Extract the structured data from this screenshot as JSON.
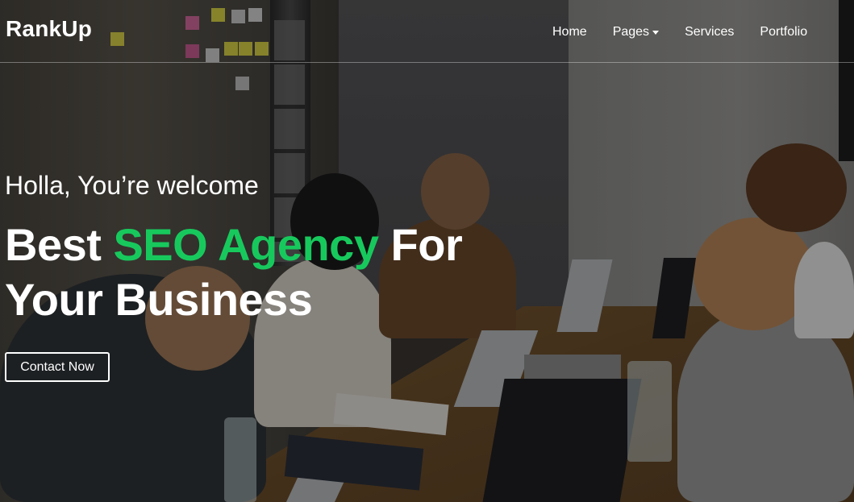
{
  "brand": {
    "name": "RankUp"
  },
  "nav": {
    "items": [
      {
        "label": "Home"
      },
      {
        "label": "Pages",
        "has_dropdown": true
      },
      {
        "label": "Services"
      },
      {
        "label": "Portfolio"
      }
    ]
  },
  "hero": {
    "subtitle": "Holla, You’re welcome",
    "headline_part1": "Best ",
    "headline_accent": "SEO Agency",
    "headline_part2": " For",
    "headline_line2": "Your Business",
    "cta_label": "Contact Now"
  },
  "colors": {
    "accent": "#17c95d",
    "text": "#ffffff"
  },
  "icons": {
    "dropdown": "caret-down-icon"
  }
}
